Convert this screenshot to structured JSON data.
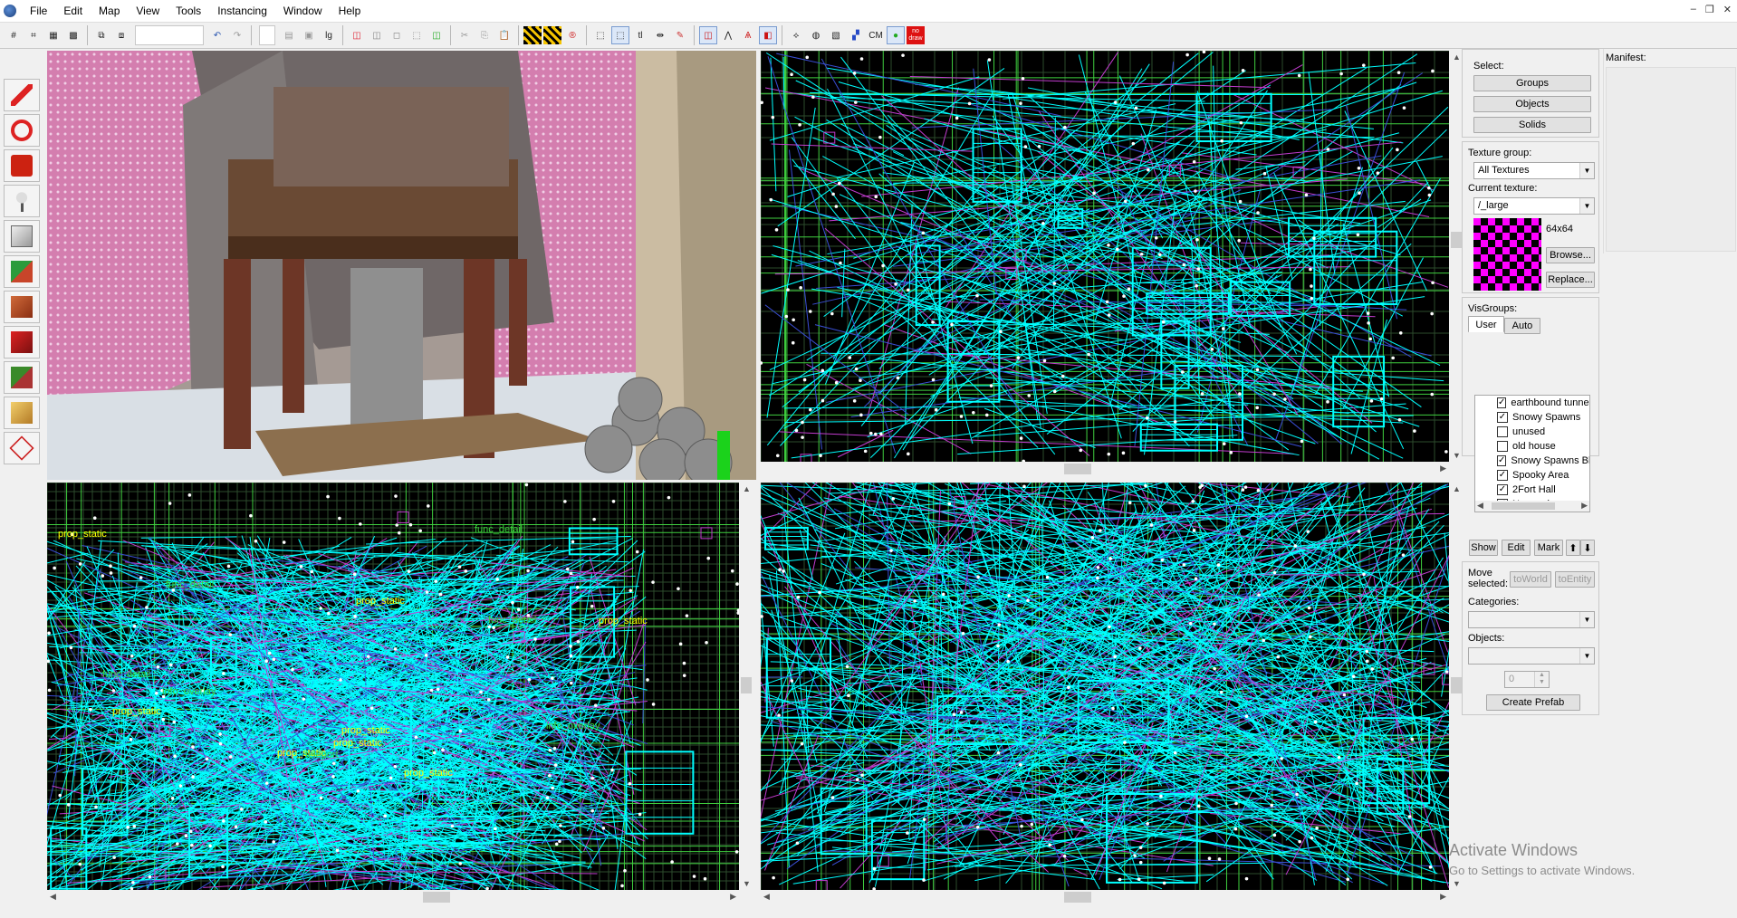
{
  "menubar": {
    "items": [
      "File",
      "Edit",
      "Map",
      "View",
      "Tools",
      "Instancing",
      "Window",
      "Help"
    ],
    "window_controls": [
      "–",
      "❐",
      "✕"
    ]
  },
  "toolbar": {
    "texture_lock_label": "lg",
    "cm_label": "CM",
    "nodraw_label": "no draw"
  },
  "colors": {
    "wire_cyan": "#00ffff",
    "wire_green": "#3fcf3f",
    "wire_blue": "#3a4fd6",
    "wire_magenta": "#c23ccf",
    "grid": "#2d4b2d",
    "label_yellow": "#ffff00",
    "label_green": "#39d339"
  },
  "viewport_labels": [
    "prop_static",
    "prop_static",
    "prop_static",
    "prop_static",
    "prop_static",
    "prop_static",
    "prop_static",
    "func_detail",
    "func_detail",
    "func_detail",
    "info_overlay",
    "info_overlay",
    "teleport",
    "prop_static",
    "func_detail"
  ],
  "right_panel": {
    "select_label": "Select:",
    "groups_button": "Groups",
    "objects_button": "Objects",
    "solids_button": "Solids",
    "texture_group_label": "Texture group:",
    "texture_group_value": "All Textures",
    "current_texture_label": "Current texture:",
    "current_texture_value": "/_large",
    "texture_size": "64x64",
    "browse_button": "Browse...",
    "replace_button": "Replace...",
    "visgroups_label": "VisGroups:",
    "tab_user": "User",
    "tab_auto": "Auto",
    "visgroups": [
      {
        "label": "earthbound tunnel",
        "checked": true
      },
      {
        "label": "Snowy Spawns",
        "checked": true
      },
      {
        "label": "unused",
        "checked": false
      },
      {
        "label": "old house",
        "checked": false
      },
      {
        "label": "Snowy Spawns Blu",
        "checked": true
      },
      {
        "label": "Spooky Area",
        "checked": true
      },
      {
        "label": "2Fort Hall",
        "checked": true
      },
      {
        "label": "No overlays",
        "checked": true
      }
    ],
    "show_button": "Show",
    "edit_button": "Edit",
    "mark_button": "Mark",
    "move_selected_label": "Move selected:",
    "to_world_button": "toWorld",
    "to_entity_button": "toEntity",
    "categories_label": "Categories:",
    "objects_label": "Objects:",
    "stepper_value": "0",
    "create_prefab_button": "Create Prefab"
  },
  "manifest": {
    "label": "Manifest:"
  },
  "watermark": {
    "title": "Activate Windows",
    "subtitle": "Go to Settings to activate Windows."
  }
}
